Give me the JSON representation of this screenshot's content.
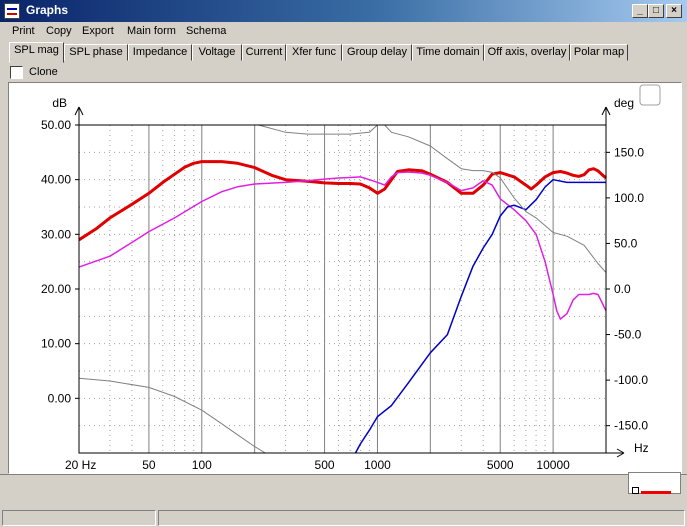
{
  "window": {
    "title": "Graphs",
    "min_label": "_",
    "max_label": "□",
    "close_label": "×"
  },
  "menu": [
    "Print",
    "Copy",
    "Export",
    "Main form",
    "Schema"
  ],
  "tabs": [
    "SPL mag",
    "SPL phase",
    "Impedance",
    "Voltage",
    "Current",
    "Xfer func",
    "Group delay",
    "Time domain",
    "Off axis, overlay",
    "Polar map"
  ],
  "active_tab": 0,
  "clone": {
    "label": "Clone",
    "checked": false
  },
  "colors": {
    "red": "#e00000",
    "magenta": "#e020e0",
    "blue": "#0000c8",
    "gray": "#808080",
    "grid": "#a0a0a0"
  },
  "chart_data": {
    "type": "line",
    "x_scale": "log",
    "xlim": [
      20,
      20000
    ],
    "ylim": [
      -10,
      50
    ],
    "ylim_right": [
      -180,
      180
    ],
    "ylabel": "dB",
    "ylabel_right": "deg",
    "xlabel": "Hz",
    "grid": true,
    "x_ticks": [
      {
        "value": 20,
        "label": "20 Hz"
      },
      {
        "value": 50,
        "label": "50"
      },
      {
        "value": 100,
        "label": "100"
      },
      {
        "value": 500,
        "label": "500"
      },
      {
        "value": 1000,
        "label": "1000"
      },
      {
        "value": 5000,
        "label": "5000"
      },
      {
        "value": 10000,
        "label": "10000"
      }
    ],
    "y_ticks": [
      "0.00",
      "10.00",
      "20.00",
      "30.00",
      "40.00",
      "50.00"
    ],
    "y_ticks_right": [
      "-150.0",
      "-100.0",
      "-50.0",
      "0.0",
      "50.0",
      "100.0",
      "150.0"
    ],
    "series": [
      {
        "axis": "left",
        "color": "#e00000",
        "width": 3,
        "points": [
          [
            20,
            29
          ],
          [
            25,
            31
          ],
          [
            30,
            33
          ],
          [
            40,
            35.5
          ],
          [
            50,
            37.5
          ],
          [
            60,
            39.5
          ],
          [
            70,
            41
          ],
          [
            80,
            42.3
          ],
          [
            90,
            43
          ],
          [
            100,
            43.3
          ],
          [
            130,
            43.3
          ],
          [
            160,
            43
          ],
          [
            200,
            42.2
          ],
          [
            250,
            40.8
          ],
          [
            300,
            40
          ],
          [
            400,
            39.7
          ],
          [
            500,
            39.4
          ],
          [
            600,
            39.3
          ],
          [
            700,
            39.3
          ],
          [
            800,
            39.2
          ],
          [
            900,
            38.5
          ],
          [
            1000,
            37.5
          ],
          [
            1100,
            38.3
          ],
          [
            1200,
            40
          ],
          [
            1300,
            41.5
          ],
          [
            1500,
            41.8
          ],
          [
            1800,
            41.6
          ],
          [
            2000,
            41
          ],
          [
            2500,
            39.5
          ],
          [
            3000,
            37.5
          ],
          [
            3500,
            37.5
          ],
          [
            4000,
            39
          ],
          [
            4500,
            41
          ],
          [
            5000,
            41.3
          ],
          [
            6000,
            40.5
          ],
          [
            7000,
            39
          ],
          [
            7500,
            38.3
          ],
          [
            8000,
            39
          ],
          [
            9000,
            40.5
          ],
          [
            10000,
            41.3
          ],
          [
            11000,
            41.5
          ],
          [
            12000,
            41.2
          ],
          [
            13000,
            40.8
          ],
          [
            14000,
            40.6
          ],
          [
            15000,
            40.9
          ],
          [
            16000,
            41.8
          ],
          [
            17000,
            42
          ],
          [
            18000,
            41.6
          ],
          [
            19000,
            40.9
          ],
          [
            20000,
            40.3
          ]
        ]
      },
      {
        "axis": "left",
        "color": "#e020e0",
        "width": 1.5,
        "points": [
          [
            20,
            24
          ],
          [
            30,
            26
          ],
          [
            40,
            28.5
          ],
          [
            50,
            30.5
          ],
          [
            70,
            33
          ],
          [
            100,
            36
          ],
          [
            130,
            37.8
          ],
          [
            160,
            38.7
          ],
          [
            200,
            39.2
          ],
          [
            300,
            39.5
          ],
          [
            400,
            39.8
          ],
          [
            500,
            40.1
          ],
          [
            600,
            40.3
          ],
          [
            700,
            40.4
          ],
          [
            800,
            40.5
          ],
          [
            900,
            40
          ],
          [
            1000,
            39.5
          ],
          [
            1100,
            39
          ],
          [
            1200,
            40.5
          ],
          [
            1300,
            41.3
          ],
          [
            1500,
            41.4
          ],
          [
            1800,
            41.2
          ],
          [
            2000,
            40.8
          ],
          [
            2500,
            39.5
          ],
          [
            3000,
            38
          ],
          [
            3500,
            38.5
          ],
          [
            4000,
            39.8
          ],
          [
            4500,
            39
          ],
          [
            5000,
            36.5
          ],
          [
            6000,
            34.5
          ],
          [
            7000,
            32.5
          ],
          [
            8000,
            30
          ],
          [
            9000,
            25
          ],
          [
            10000,
            19
          ],
          [
            10500,
            16
          ],
          [
            11000,
            14.5
          ],
          [
            12000,
            15.5
          ],
          [
            13000,
            18
          ],
          [
            14000,
            19
          ],
          [
            15000,
            19
          ],
          [
            16000,
            19
          ],
          [
            17000,
            19.2
          ],
          [
            18000,
            19
          ],
          [
            19000,
            17.5
          ],
          [
            20000,
            16
          ]
        ]
      },
      {
        "axis": "right",
        "color": "#0000c8",
        "width": 1.5,
        "points": [
          [
            750,
            -180
          ],
          [
            800,
            -170
          ],
          [
            900,
            -155
          ],
          [
            1000,
            -140
          ],
          [
            1200,
            -128
          ],
          [
            1500,
            -103
          ],
          [
            2000,
            -70
          ],
          [
            2500,
            -50
          ],
          [
            3000,
            -8
          ],
          [
            3500,
            25
          ],
          [
            4000,
            45
          ],
          [
            4500,
            60
          ],
          [
            5000,
            80
          ],
          [
            5500,
            90
          ],
          [
            6000,
            92
          ],
          [
            7000,
            87
          ],
          [
            8000,
            98
          ],
          [
            9000,
            112
          ],
          [
            10000,
            120
          ],
          [
            12000,
            117
          ],
          [
            15000,
            117
          ],
          [
            20000,
            117
          ]
        ]
      },
      {
        "axis": "right",
        "color": "#808080",
        "width": 1,
        "points": [
          [
            20,
            -98
          ],
          [
            30,
            -101
          ],
          [
            50,
            -108
          ],
          [
            70,
            -118
          ],
          [
            100,
            -133
          ],
          [
            130,
            -148
          ],
          [
            160,
            -160
          ],
          [
            200,
            -173
          ],
          [
            230,
            -180
          ]
        ]
      },
      {
        "axis": "right",
        "color": "#808080",
        "width": 1,
        "points": [
          [
            210,
            180
          ],
          [
            300,
            172
          ],
          [
            400,
            170
          ],
          [
            500,
            170
          ],
          [
            700,
            170
          ],
          [
            900,
            172
          ],
          [
            1000,
            180
          ],
          [
            1100,
            180
          ],
          [
            1200,
            172
          ],
          [
            1500,
            167
          ],
          [
            2000,
            157
          ],
          [
            2500,
            143
          ],
          [
            3000,
            132
          ],
          [
            3500,
            130
          ],
          [
            4000,
            130
          ],
          [
            4500,
            128
          ],
          [
            5000,
            122
          ],
          [
            6000,
            100
          ],
          [
            7000,
            85
          ],
          [
            8000,
            78
          ],
          [
            10000,
            62
          ],
          [
            12000,
            58
          ],
          [
            15000,
            48
          ],
          [
            18000,
            28
          ],
          [
            20000,
            18
          ]
        ]
      }
    ]
  }
}
